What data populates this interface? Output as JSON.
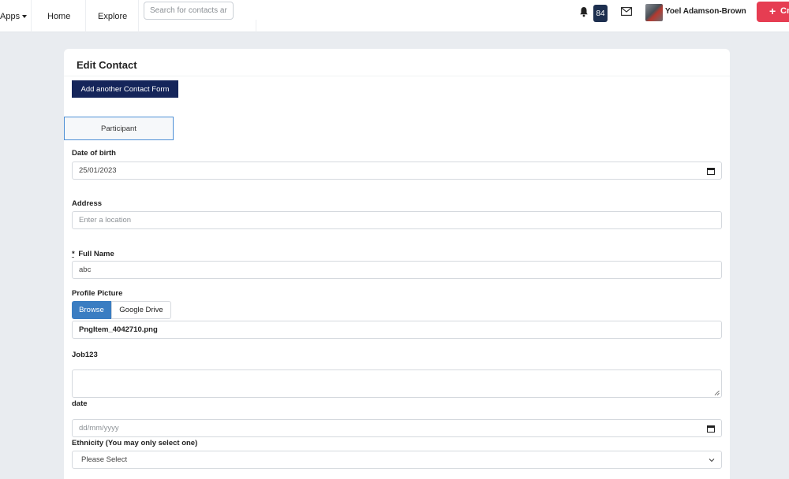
{
  "topbar": {
    "apps_label": "Apps",
    "home_label": "Home",
    "explore_label": "Explore",
    "search_placeholder": "Search for contacts ar",
    "notification_count": "84",
    "user_name": "Yoel Adamson-Brown",
    "create_label": "Cr",
    "create_color": "#e63d52"
  },
  "card": {
    "title": "Edit Contact",
    "add_form_label": "Add another Contact Form",
    "tab_label": "Participant"
  },
  "form": {
    "dob": {
      "label": "Date of birth",
      "value": "25/01/2023"
    },
    "address": {
      "label": "Address",
      "placeholder": "Enter a location"
    },
    "full_name": {
      "required_mark": "*",
      "label": "Full Name",
      "value": "abc"
    },
    "profile_picture": {
      "label": "Profile Picture",
      "browse_label": "Browse",
      "gdrive_label": "Google Drive",
      "file_name": "PngItem_4042710.png"
    },
    "job": {
      "label": "Job123"
    },
    "date": {
      "label": "date",
      "placeholder": "dd/mm/yyyy"
    },
    "ethnicity": {
      "label": "Ethnicity (You may only select one)",
      "selected": "Please Select"
    }
  },
  "icons": {
    "bell": "bell-icon",
    "mail": "envelope-icon",
    "calendar": "calendar-icon",
    "chevron": "chevron-down-icon",
    "plus": "plus-icon"
  },
  "colors": {
    "navy_button": "#15255a",
    "browse_blue": "#3a7dc2",
    "badge": "#1d2f4f",
    "tab_border": "#4d8fd6"
  }
}
